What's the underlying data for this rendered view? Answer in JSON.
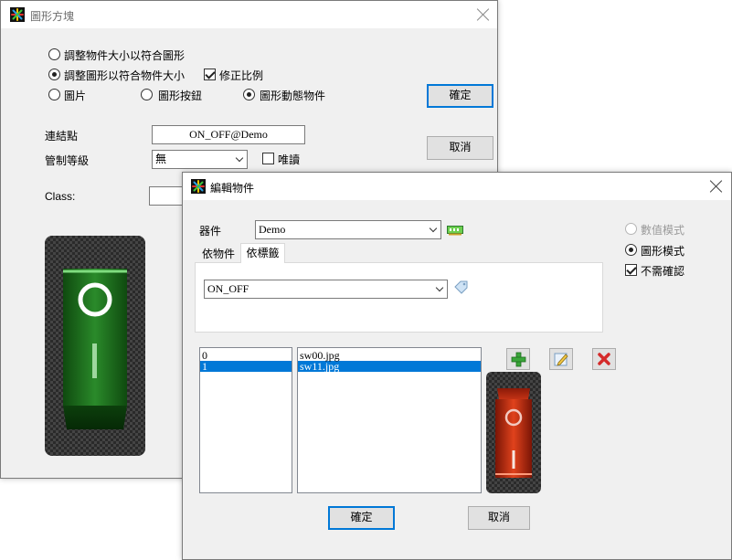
{
  "back_dialog": {
    "title": "圖形方塊",
    "radio_options": [
      {
        "label": "調整物件大小以符合圖形",
        "checked": false
      },
      {
        "label": "調整圖形以符合物件大小",
        "checked": true
      }
    ],
    "keep_ratio_label": "修正比例",
    "keep_ratio_checked": true,
    "type_options": [
      {
        "label": "圖片",
        "checked": false
      },
      {
        "label": "圖形按鈕",
        "checked": false
      },
      {
        "label": "圖形動態物件",
        "checked": true
      }
    ],
    "ok_label": "確定",
    "cancel_label": "取消",
    "link_point_label": "連結點",
    "link_point_value": "ON_OFF@Demo",
    "control_level_label": "管制等級",
    "control_level_value": "無",
    "readonly_label": "唯讀",
    "readonly_checked": false,
    "class_label": "Class:",
    "class_value": ""
  },
  "front_dialog": {
    "title": "編輯物件",
    "device_label": "器件",
    "device_value": "Demo",
    "tabs": [
      {
        "label": "依物件",
        "active": false
      },
      {
        "label": "依標籤",
        "active": true
      }
    ],
    "tag_value": "ON_OFF",
    "mode_options": [
      {
        "label": "數值模式",
        "checked": false,
        "disabled": true
      },
      {
        "label": "圖形模式",
        "checked": true,
        "disabled": false
      }
    ],
    "no_confirm_label": "不需確認",
    "no_confirm_checked": true,
    "values_list": [
      "0",
      "1"
    ],
    "images_list": [
      "sw00.jpg",
      "sw11.jpg"
    ],
    "selected_index": 1,
    "ok_label": "確定",
    "cancel_label": "取消"
  },
  "icons": {
    "app": "app-star-icon",
    "add": "plus-icon",
    "edit": "edit-pencil-icon",
    "delete": "delete-x-icon",
    "device": "network-card-icon",
    "tag": "tag-icon"
  },
  "colors": {
    "accent": "#0078d7",
    "switch_green": "#1f6d1f",
    "switch_red": "#b8280e"
  }
}
